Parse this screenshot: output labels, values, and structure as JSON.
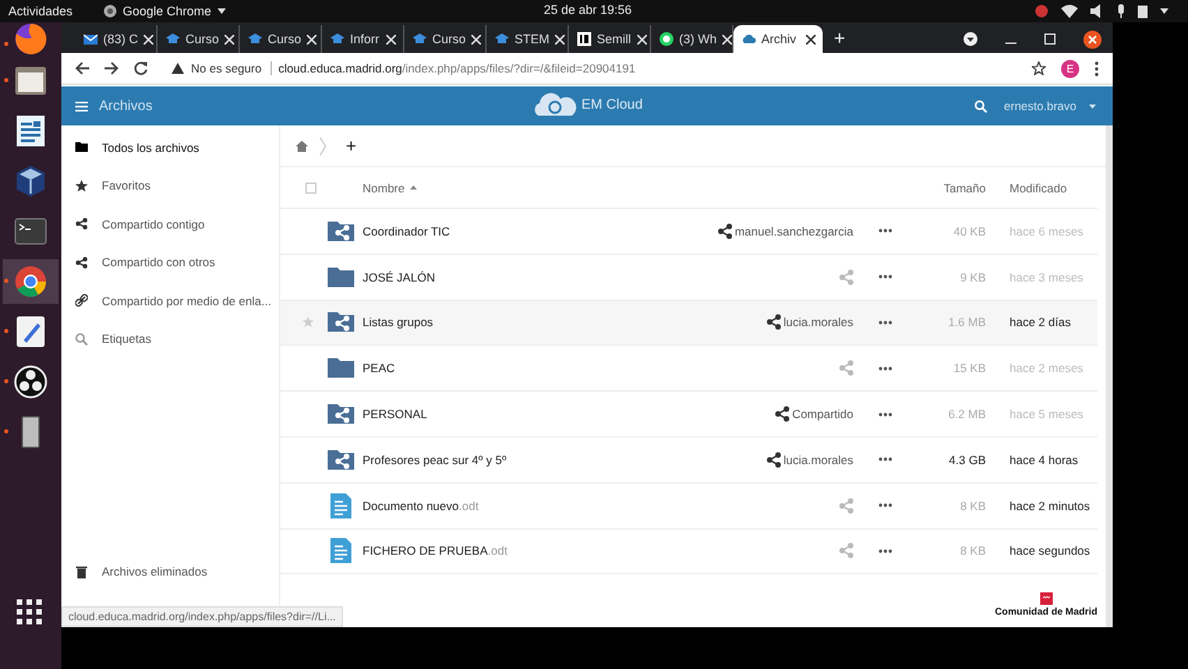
{
  "top_bar": {
    "activities": "Actividades",
    "app": "Google Chrome",
    "clock": "25 de abr  19:56"
  },
  "dock": [
    {
      "kind": "firefox",
      "running": true,
      "selected": false
    },
    {
      "kind": "files",
      "running": true,
      "selected": false
    },
    {
      "kind": "writer",
      "running": false,
      "selected": false
    },
    {
      "kind": "virtualbox",
      "running": false,
      "selected": false
    },
    {
      "kind": "terminal",
      "running": false,
      "selected": false
    },
    {
      "kind": "chrome",
      "running": true,
      "selected": true
    },
    {
      "kind": "editor",
      "running": true,
      "selected": false
    },
    {
      "kind": "obs",
      "running": true,
      "selected": false
    },
    {
      "kind": "device",
      "running": true,
      "selected": false
    }
  ],
  "browser": {
    "tabs": [
      {
        "label": "(83) C",
        "kind": "mail",
        "selected": false
      },
      {
        "label": "Curso",
        "kind": "edu",
        "selected": false
      },
      {
        "label": "Curso",
        "kind": "edu",
        "selected": false
      },
      {
        "label": "Inforr",
        "kind": "edu",
        "selected": false
      },
      {
        "label": "Curso",
        "kind": "edu",
        "selected": false
      },
      {
        "label": "STEM",
        "kind": "edu",
        "selected": false
      },
      {
        "label": "Semill",
        "kind": "site",
        "selected": false
      },
      {
        "label": "(3) Wh",
        "kind": "chat",
        "selected": false
      },
      {
        "label": "Archiv",
        "kind": "cloud",
        "selected": true
      }
    ],
    "new_tab": "+",
    "security": "No es seguro",
    "url_host": "cloud.educa.madrid.org",
    "url_path": "/index.php/apps/files/?dir=/&fileid=20904191",
    "profile": "E"
  },
  "app": {
    "title": "Archivos",
    "brand": "EM Cloud",
    "user": "ernesto.bravo",
    "sidebar": [
      {
        "label": "Todos los archivos",
        "kind": "folder",
        "selected": true
      },
      {
        "label": "Favoritos",
        "kind": "star",
        "selected": false
      },
      {
        "label": "Compartido contigo",
        "kind": "share",
        "selected": false
      },
      {
        "label": "Compartido con otros",
        "kind": "share",
        "selected": false
      },
      {
        "label": "Compartido por medio de enla...",
        "kind": "link",
        "selected": false
      },
      {
        "label": "Etiquetas",
        "kind": "tag",
        "selected": false
      }
    ],
    "sidebar_bottom": [
      {
        "label": "Archivos eliminados",
        "kind": "trash"
      }
    ],
    "new_button": "+",
    "columns": {
      "name": "Nombre",
      "size": "Tamaño",
      "modified": "Modificado",
      "select_all_checked": false
    },
    "files": [
      {
        "name": "Coordinador TIC",
        "kind": "shared-folder",
        "share": "manuel.sanchezgarcia",
        "size": "40 KB",
        "modified": "hace 6 meses",
        "hovered": false,
        "size_strong": false,
        "modified_strong": false
      },
      {
        "name": "JOSÉ JALÓN",
        "kind": "folder",
        "size": "9 KB",
        "modified": "hace 3 meses",
        "hovered": false,
        "size_strong": false,
        "modified_strong": false
      },
      {
        "name": "Listas grupos",
        "kind": "shared-folder",
        "share": "lucia.morales",
        "size": "1.6 MB",
        "modified": "hace 2 días",
        "hovered": true,
        "size_strong": false,
        "modified_strong": true
      },
      {
        "name": "PEAC",
        "kind": "folder",
        "size": "15 KB",
        "modified": "hace 2 meses",
        "hovered": false,
        "size_strong": false,
        "modified_strong": false
      },
      {
        "name": "PERSONAL",
        "kind": "shared-folder",
        "share": "Compartido",
        "size": "6.2 MB",
        "modified": "hace 5 meses",
        "hovered": false,
        "size_strong": false,
        "modified_strong": false
      },
      {
        "name": "Profesores peac sur 4º y 5º",
        "kind": "shared-folder",
        "share": "lucia.morales",
        "size": "4.3 GB",
        "modified": "hace 4 horas",
        "hovered": false,
        "size_strong": true,
        "modified_strong": true
      },
      {
        "name": "Documento nuevo",
        "ext": ".odt",
        "kind": "document",
        "size": "8 KB",
        "modified": "hace 2 minutos",
        "hovered": false,
        "size_strong": false,
        "modified_strong": true
      },
      {
        "name": "FICHERO DE PRUEBA",
        "ext": ".odt",
        "kind": "document",
        "size": "8 KB",
        "modified": "hace segundos",
        "hovered": false,
        "size_strong": false,
        "modified_strong": true
      }
    ],
    "footer_logo": "Comunidad de Madrid"
  },
  "status_url": "cloud.educa.madrid.org/index.php/apps/files?dir=//Li..."
}
